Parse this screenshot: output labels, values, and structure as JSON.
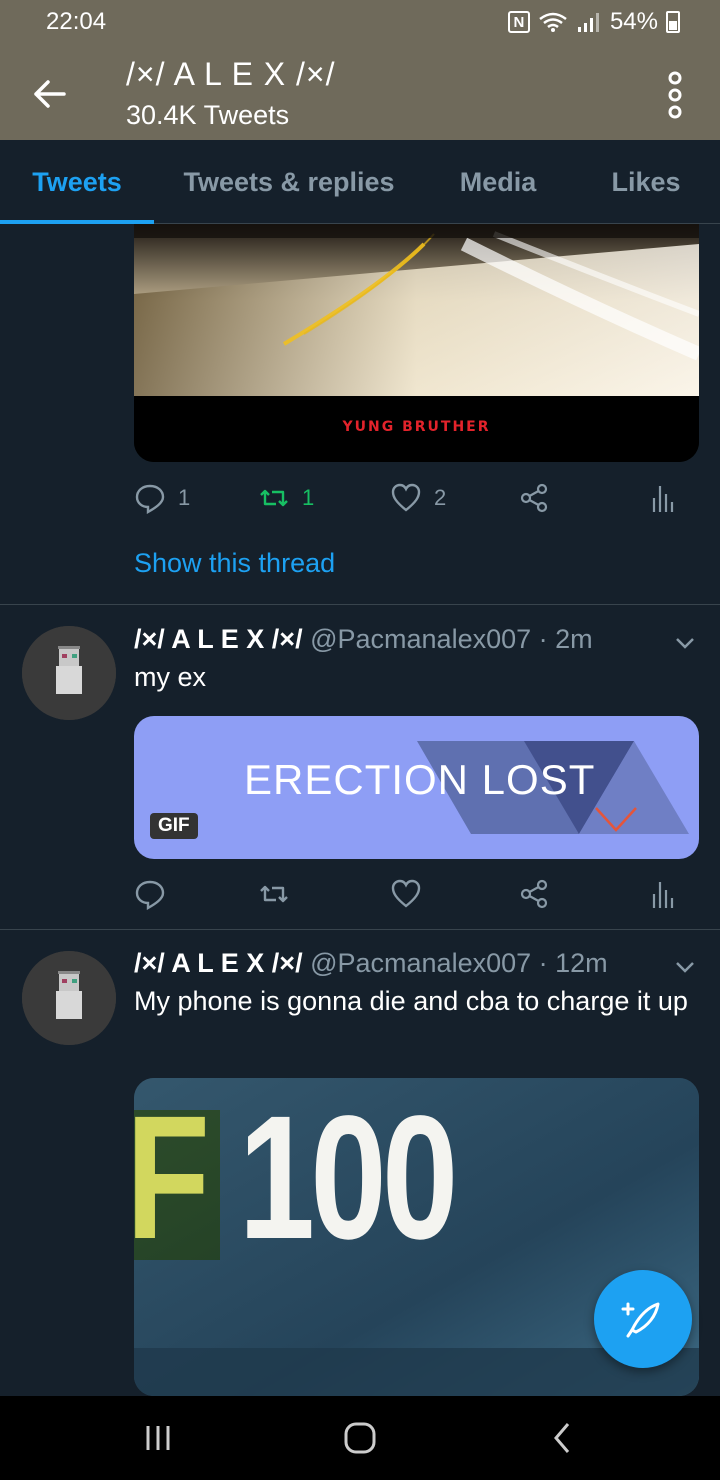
{
  "status_bar": {
    "time": "22:04",
    "battery": "54%",
    "nfc_label": "N"
  },
  "header": {
    "title": "/×/ A L E X /×/",
    "subtitle": "30.4K Tweets"
  },
  "tabs": [
    {
      "label": "Tweets",
      "active": true
    },
    {
      "label": "Tweets & replies",
      "active": false
    },
    {
      "label": "Media",
      "active": false
    },
    {
      "label": "Likes",
      "active": false
    }
  ],
  "top_tweet": {
    "video_caption": "YUNG BRUTHER",
    "replies": "1",
    "retweets": "1",
    "likes": "2",
    "show_thread": "Show this thread"
  },
  "tweets": [
    {
      "name": "/×/ A L E X /×/",
      "handle": "@Pacmanalex007",
      "time": "· 2m",
      "text": "my ex",
      "gif_text": "ERECTION LOST",
      "gif_badge": "GIF"
    },
    {
      "name": "/×/ A L E X /×/",
      "handle": "@Pacmanalex007",
      "time": "· 12m",
      "text": "My phone is gonna die and cba to charge it up",
      "image_text": "F 100"
    }
  ],
  "colors": {
    "accent": "#1da1f2",
    "background": "#15202b",
    "header": "#6f6a5b",
    "muted": "#8899a6",
    "retweet": "#17bf63"
  }
}
